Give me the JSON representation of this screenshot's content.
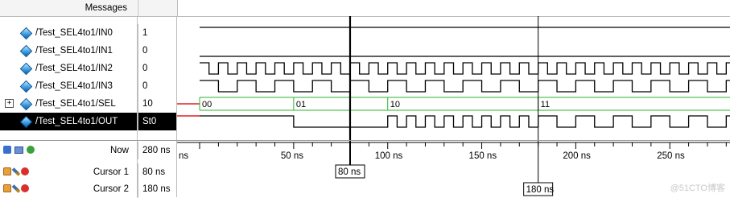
{
  "header": {
    "messages_label": "Messages"
  },
  "signals": [
    {
      "name": "/Test_SEL4to1/IN0",
      "value": "1",
      "expandable": false,
      "selected": false
    },
    {
      "name": "/Test_SEL4to1/IN1",
      "value": "0",
      "expandable": false,
      "selected": false
    },
    {
      "name": "/Test_SEL4to1/IN2",
      "value": "0",
      "expandable": false,
      "selected": false
    },
    {
      "name": "/Test_SEL4to1/IN3",
      "value": "0",
      "expandable": false,
      "selected": false
    },
    {
      "name": "/Test_SEL4to1/SEL",
      "value": "10",
      "expandable": true,
      "selected": false
    },
    {
      "name": "/Test_SEL4to1/OUT",
      "value": "St0",
      "expandable": false,
      "selected": true
    }
  ],
  "bus_labels": [
    "00",
    "01",
    "10",
    "11"
  ],
  "now": {
    "label": "Now",
    "value": "280 ns"
  },
  "cursors": [
    {
      "label": "Cursor 1",
      "value": "80 ns",
      "time_ns": 80
    },
    {
      "label": "Cursor 2",
      "value": "180 ns",
      "time_ns": 180
    }
  ],
  "axis": {
    "unit": "ns",
    "tick_labels": [
      "ns",
      "50 ns",
      "100 ns",
      "150 ns",
      "200 ns",
      "250 ns"
    ],
    "range_ns": [
      -12,
      282
    ]
  },
  "watermark": "@51CTO博客",
  "colors": {
    "waveform": "#000000",
    "uninit": "#e02020",
    "cursor": "#000000",
    "selected_row_bg": "#000000",
    "bus_text": "#000000"
  },
  "icons": [
    "expand-plus-icon",
    "signal-diamond-icon",
    "zoom-icon",
    "lock-icon",
    "pencil-icon",
    "remove-cursor-icon",
    "add-cursor-icon"
  ]
}
